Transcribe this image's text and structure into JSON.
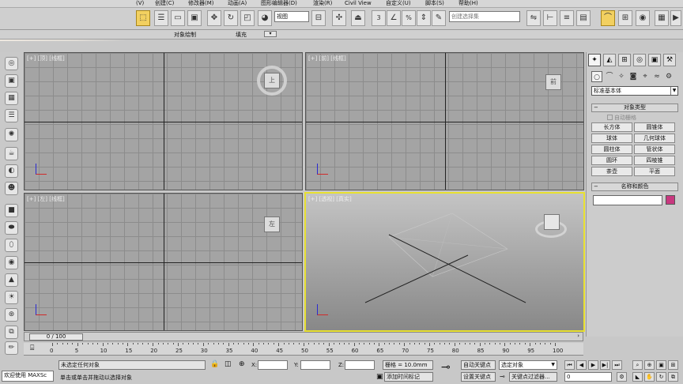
{
  "menu": [
    {
      "label": "(V)"
    },
    {
      "label": "创建(C)"
    },
    {
      "label": "修改器(M)"
    },
    {
      "label": "动画(A)"
    },
    {
      "label": "图形编辑器(D)"
    },
    {
      "label": "渲染(R)"
    },
    {
      "label": "Civil View"
    },
    {
      "label": "自定义(U)"
    },
    {
      "label": "脚本(S)"
    },
    {
      "label": "帮助(H)"
    }
  ],
  "toolbar": {
    "ref_coord": "视图",
    "snap_value": "3",
    "named_selection_placeholder": "创建选择集",
    "icons": [
      "select-object-icon",
      "select-region-icon",
      "window-crossing-icon",
      "move-icon",
      "rotate-icon",
      "scale-icon",
      "pivot-icon",
      "select-manipulate-icon",
      "snap-icon",
      "angle-snap-icon",
      "percent-snap-icon",
      "spinner-snap-icon",
      "mirror-icon",
      "align-icon",
      "layer-icon",
      "curve-editor-icon",
      "render-setup-icon",
      "render-frame-icon",
      "render-icon"
    ]
  },
  "ribbon": {
    "object_paint": "对象绘制",
    "fill": "填充"
  },
  "viewports": [
    {
      "id": "top",
      "label": "[+] [顶] [线框]",
      "cube": "上"
    },
    {
      "id": "front",
      "label": "[+] [前] [线框]",
      "cube": "前"
    },
    {
      "id": "left",
      "label": "[+] [左] [线框]",
      "cube": "左"
    },
    {
      "id": "perspective",
      "label": "[+] [透视] [真实]",
      "cube": ""
    }
  ],
  "command_panel": {
    "tabs": [
      "create-tab-icon",
      "modify-tab-icon",
      "hierarchy-tab-icon",
      "motion-tab-icon",
      "display-tab-icon",
      "utilities-tab-icon"
    ],
    "category": "标准基本体",
    "object_type_title": "对象类型",
    "auto_grid": "自动栅格",
    "objects": [
      "长方体",
      "圆锥体",
      "球体",
      "几何球体",
      "圆柱体",
      "管状体",
      "圆环",
      "四棱锥",
      "茶壶",
      "平面"
    ],
    "name_color_title": "名称和颜色",
    "name_value": "",
    "color": "#c8387f"
  },
  "timeline": {
    "position": "0 / 100",
    "ticks": [
      "0",
      "5",
      "10",
      "15",
      "20",
      "25",
      "30",
      "35",
      "40",
      "45",
      "50",
      "55",
      "60",
      "65",
      "70",
      "75",
      "80",
      "85",
      "90",
      "95",
      "100"
    ]
  },
  "status": {
    "welcome": "欢迎使用 MAXSc",
    "selection": "未选定任何对象",
    "prompt": "单击或单击并拖动以选择对象",
    "x_label": "X:",
    "y_label": "Y:",
    "z_label": "Z:",
    "grid": "栅格 = 10.0mm",
    "add_time_tag": "添加时间标记",
    "auto_key": "自动关键点",
    "set_key": "设置关键点",
    "key_filter": "选定对象",
    "key_filters_button": "关键点过滤器...",
    "frame": "0"
  }
}
